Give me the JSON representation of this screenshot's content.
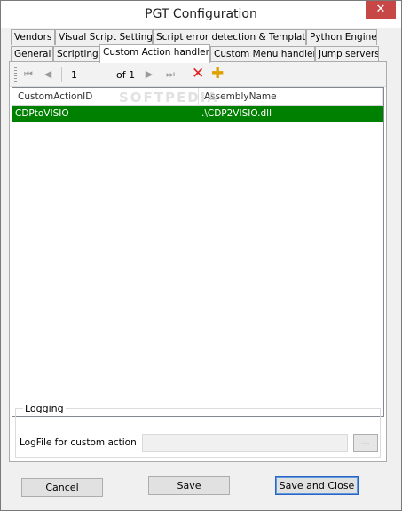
{
  "window": {
    "title": "PGT Configuration",
    "close_glyph": "✕"
  },
  "tabs_row1": [
    "Vendors",
    "Visual Script Settings",
    "Script error detection & Templates",
    "Python Engine"
  ],
  "tabs_row2": [
    "General",
    "Scripting",
    "Custom Action handlers",
    "Custom Menu handlers",
    "Jump servers"
  ],
  "active_tab": "Custom Action handlers",
  "navigator": {
    "first_glyph": "⏮",
    "prev_glyph": "◀",
    "next_glyph": "▶",
    "last_glyph": "⏭",
    "position": "1",
    "of_label": "of 1",
    "delete_glyph": "✕",
    "add_glyph": "✚"
  },
  "grid": {
    "columns": [
      "CustomActionID",
      "AssemblyName"
    ],
    "rows": [
      {
        "id": "CDPtoVISIO",
        "assembly": ".\\CDP2VISIO.dll"
      }
    ],
    "selected_row_color": "#008000"
  },
  "logging": {
    "legend": "Logging",
    "logfile_label": "LogFile for custom action",
    "logfile_value": "",
    "browse_label": "..."
  },
  "buttons": {
    "cancel": "Cancel",
    "save": "Save",
    "save_close": "Save and Close"
  },
  "watermark": "SOFTPEDIA"
}
